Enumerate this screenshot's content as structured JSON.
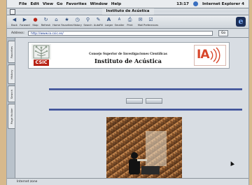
{
  "menubar": {
    "items": [
      "File",
      "Edit",
      "View",
      "Go",
      "Favorites",
      "Window",
      "Help"
    ],
    "clock": "13:17",
    "app_name": "Internet Explorer 4"
  },
  "window": {
    "title": "Instituto de Acústica"
  },
  "toolbar": {
    "buttons": [
      "Back",
      "Forward",
      "Stop",
      "Refresh",
      "Home",
      "Favorites",
      "History",
      "Search",
      "AutoFill",
      "Larger",
      "Smaller",
      "Print",
      "Mail",
      "Preferences"
    ]
  },
  "address": {
    "label": "Address:",
    "url": "http://www.ia.csic.es/",
    "go_label": "Go"
  },
  "sidetabs": [
    "Favorites",
    "History",
    "Search",
    "Page Holder"
  ],
  "page": {
    "logo_left_text": "CSIC",
    "header_small": "Consejo Superior de Investigaciones Científicas",
    "header_big": "Instituto de Acústica",
    "logo_right_text": "IA"
  },
  "status": {
    "text": "Internet zone"
  },
  "colors": {
    "accent_rule": "#2d3f86",
    "csic_red": "#b82316",
    "ia_red": "#d8462a"
  }
}
